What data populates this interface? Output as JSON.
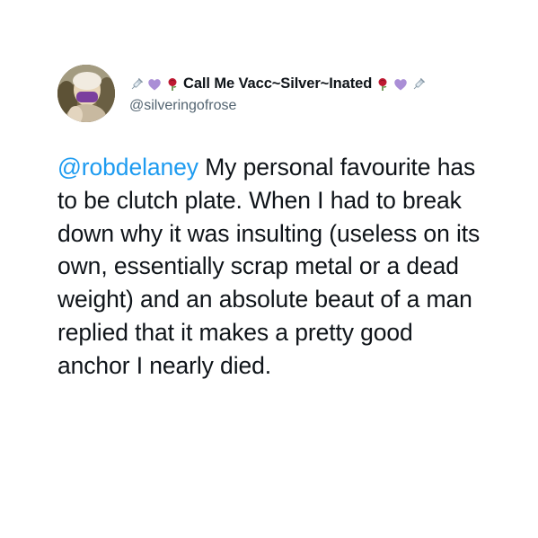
{
  "tweet": {
    "display_name": "Call Me Vacc~Silver~Inated",
    "handle": "@silveringofrose",
    "mention": "@robdelaney",
    "body": " My personal favourite has to be clutch plate. When I had to break down why it was insulting (useless on its own, essentially scrap metal or a dead weight) and an absolute beaut of a man replied that it makes a pretty good anchor I nearly died.",
    "name_emojis_left": [
      "syringe-icon",
      "purple-heart-icon",
      "rose-icon"
    ],
    "name_emojis_right": [
      "rose-icon",
      "purple-heart-icon",
      "syringe-icon"
    ]
  },
  "colors": {
    "mention": "#1d9bf0",
    "text": "#0f1419",
    "handle": "#536471",
    "heart": "#aa8ed6",
    "rose": "#be1931"
  }
}
